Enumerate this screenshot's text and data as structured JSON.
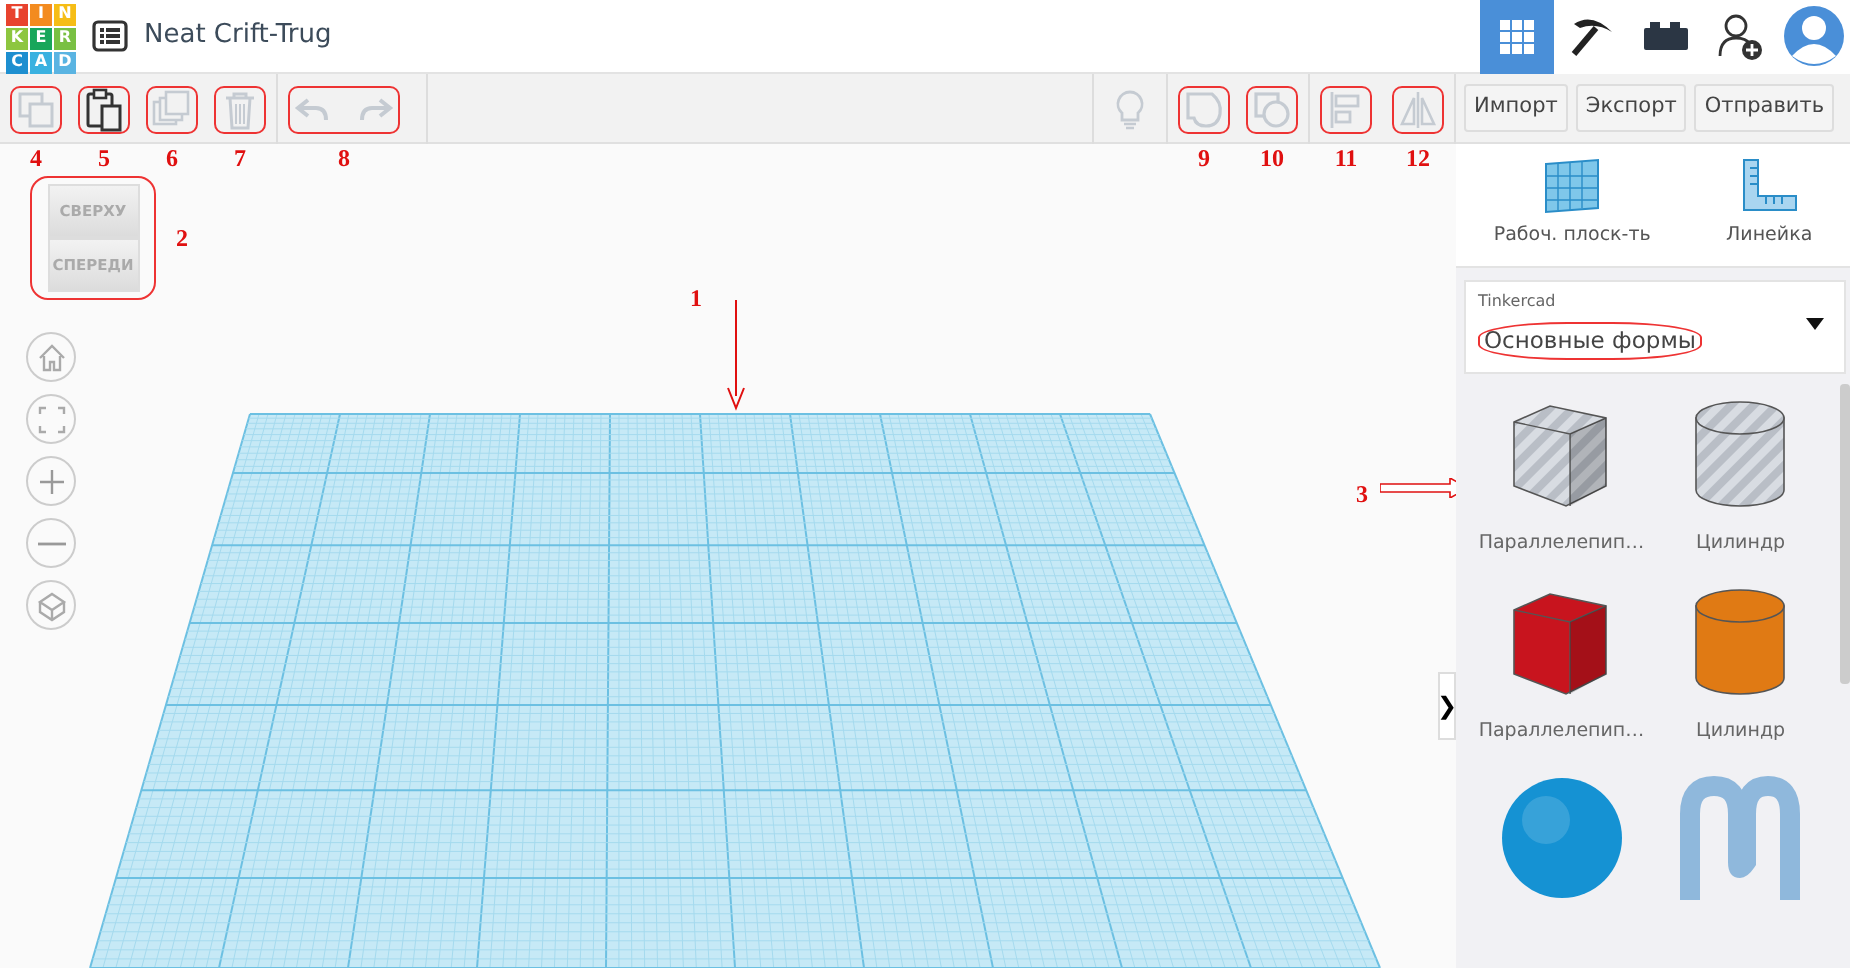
{
  "app": {
    "logo_letters": [
      "T",
      "I",
      "N",
      "K",
      "E",
      "R",
      "C",
      "A",
      "D"
    ],
    "title": "Neat Crift-Trug"
  },
  "top_icons": [
    {
      "kind": "grid",
      "selected": true
    },
    {
      "kind": "pickaxe",
      "selected": false
    },
    {
      "kind": "bricks",
      "selected": false
    },
    {
      "kind": "user-add",
      "selected": false
    },
    {
      "kind": "avatar",
      "selected": false
    }
  ],
  "toolbar_left": [
    {
      "kind": "copy",
      "disabled": true,
      "callout": "4"
    },
    {
      "kind": "paste",
      "disabled": false,
      "callout": "5"
    },
    {
      "kind": "duplicate",
      "disabled": true,
      "callout": "6"
    },
    {
      "kind": "delete",
      "disabled": true,
      "callout": "7"
    },
    {
      "kind": "undo-redo",
      "disabled": true,
      "callout": "8"
    }
  ],
  "toolbar_right": [
    {
      "kind": "bulb",
      "disabled": true
    },
    {
      "kind": "group",
      "disabled": true,
      "callout": "9"
    },
    {
      "kind": "ungroup",
      "disabled": true,
      "callout": "10"
    },
    {
      "kind": "align",
      "disabled": true,
      "callout": "11"
    },
    {
      "kind": "mirror",
      "disabled": true,
      "callout": "12"
    }
  ],
  "actions": [
    "Импорт",
    "Экспорт",
    "Отправить"
  ],
  "view_cube": {
    "top": "СВЕРХУ",
    "front": "СПЕРЕДИ",
    "callout": "2"
  },
  "nav": [
    {
      "kind": "home"
    },
    {
      "kind": "fit"
    },
    {
      "kind": "zoom-in"
    },
    {
      "kind": "zoom-out"
    },
    {
      "kind": "perspective"
    }
  ],
  "workplane": {
    "callout": "1"
  },
  "panel_tools": [
    {
      "kind": "workplane",
      "label": "Рабоч. плоск-ть"
    },
    {
      "kind": "ruler",
      "label": "Линейка"
    }
  ],
  "library": {
    "caption": "Tinkercad",
    "value": "Основные формы",
    "circled": true
  },
  "shapes_callout": "3",
  "shapes": [
    {
      "kind": "box",
      "label": "Параллелепип…",
      "color": "#b9bec6",
      "striped": true
    },
    {
      "kind": "cylinder",
      "label": "Цилиндр",
      "color": "#b9bec6",
      "striped": true
    },
    {
      "kind": "box",
      "label": "Параллелепип…",
      "color": "#c8141e",
      "striped": false
    },
    {
      "kind": "cylinder",
      "label": "Цилиндр",
      "color": "#e07a14",
      "striped": false
    },
    {
      "kind": "sphere",
      "color": "#1592d3",
      "striped": false
    },
    {
      "kind": "scribble",
      "color": "#8fb8dc",
      "striped": false
    }
  ],
  "collapse": "❯"
}
